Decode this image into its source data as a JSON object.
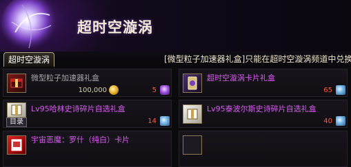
{
  "header": {
    "title": "超时空漩涡"
  },
  "tabs": [
    {
      "label": "超时空漩涡",
      "active": true
    }
  ],
  "notice": "[微型粒子加速器礼盒]只能在超时空漩涡频道中兑换",
  "items": [
    {
      "name": "微型粒子加速器礼盒",
      "price_primary": "100,000",
      "price_secondary": "5",
      "currency_primary": "gold-coin-icon",
      "currency_secondary": "space-orb-icon",
      "name_color": "#a9a4ad"
    },
    {
      "name": "超时空漩涡卡片礼盒",
      "price_secondary": "65",
      "currency_secondary": "crystal-icon",
      "name_color": "#d95cf2"
    },
    {
      "name": "Lv95哈林史诗碎片自选礼盒",
      "catalog_label": "目录",
      "price_secondary": "14",
      "currency_secondary": "crystal-icon",
      "name_color": "#d95cf2"
    },
    {
      "name": "Lv95泰波尔斯史诗碎片自选礼盒",
      "price_secondary": "40",
      "currency_secondary": "crystal-icon",
      "name_color": "#d95cf2"
    },
    {
      "name": "宇宙恶魔：罗什（纯白）卡片",
      "name_color": "#d95cf2"
    },
    {
      "name": ""
    }
  ],
  "colors": {
    "price_primary": "#d9cfa6",
    "price_secondary": "#ff5a3c",
    "title": "#f4ecd6"
  }
}
